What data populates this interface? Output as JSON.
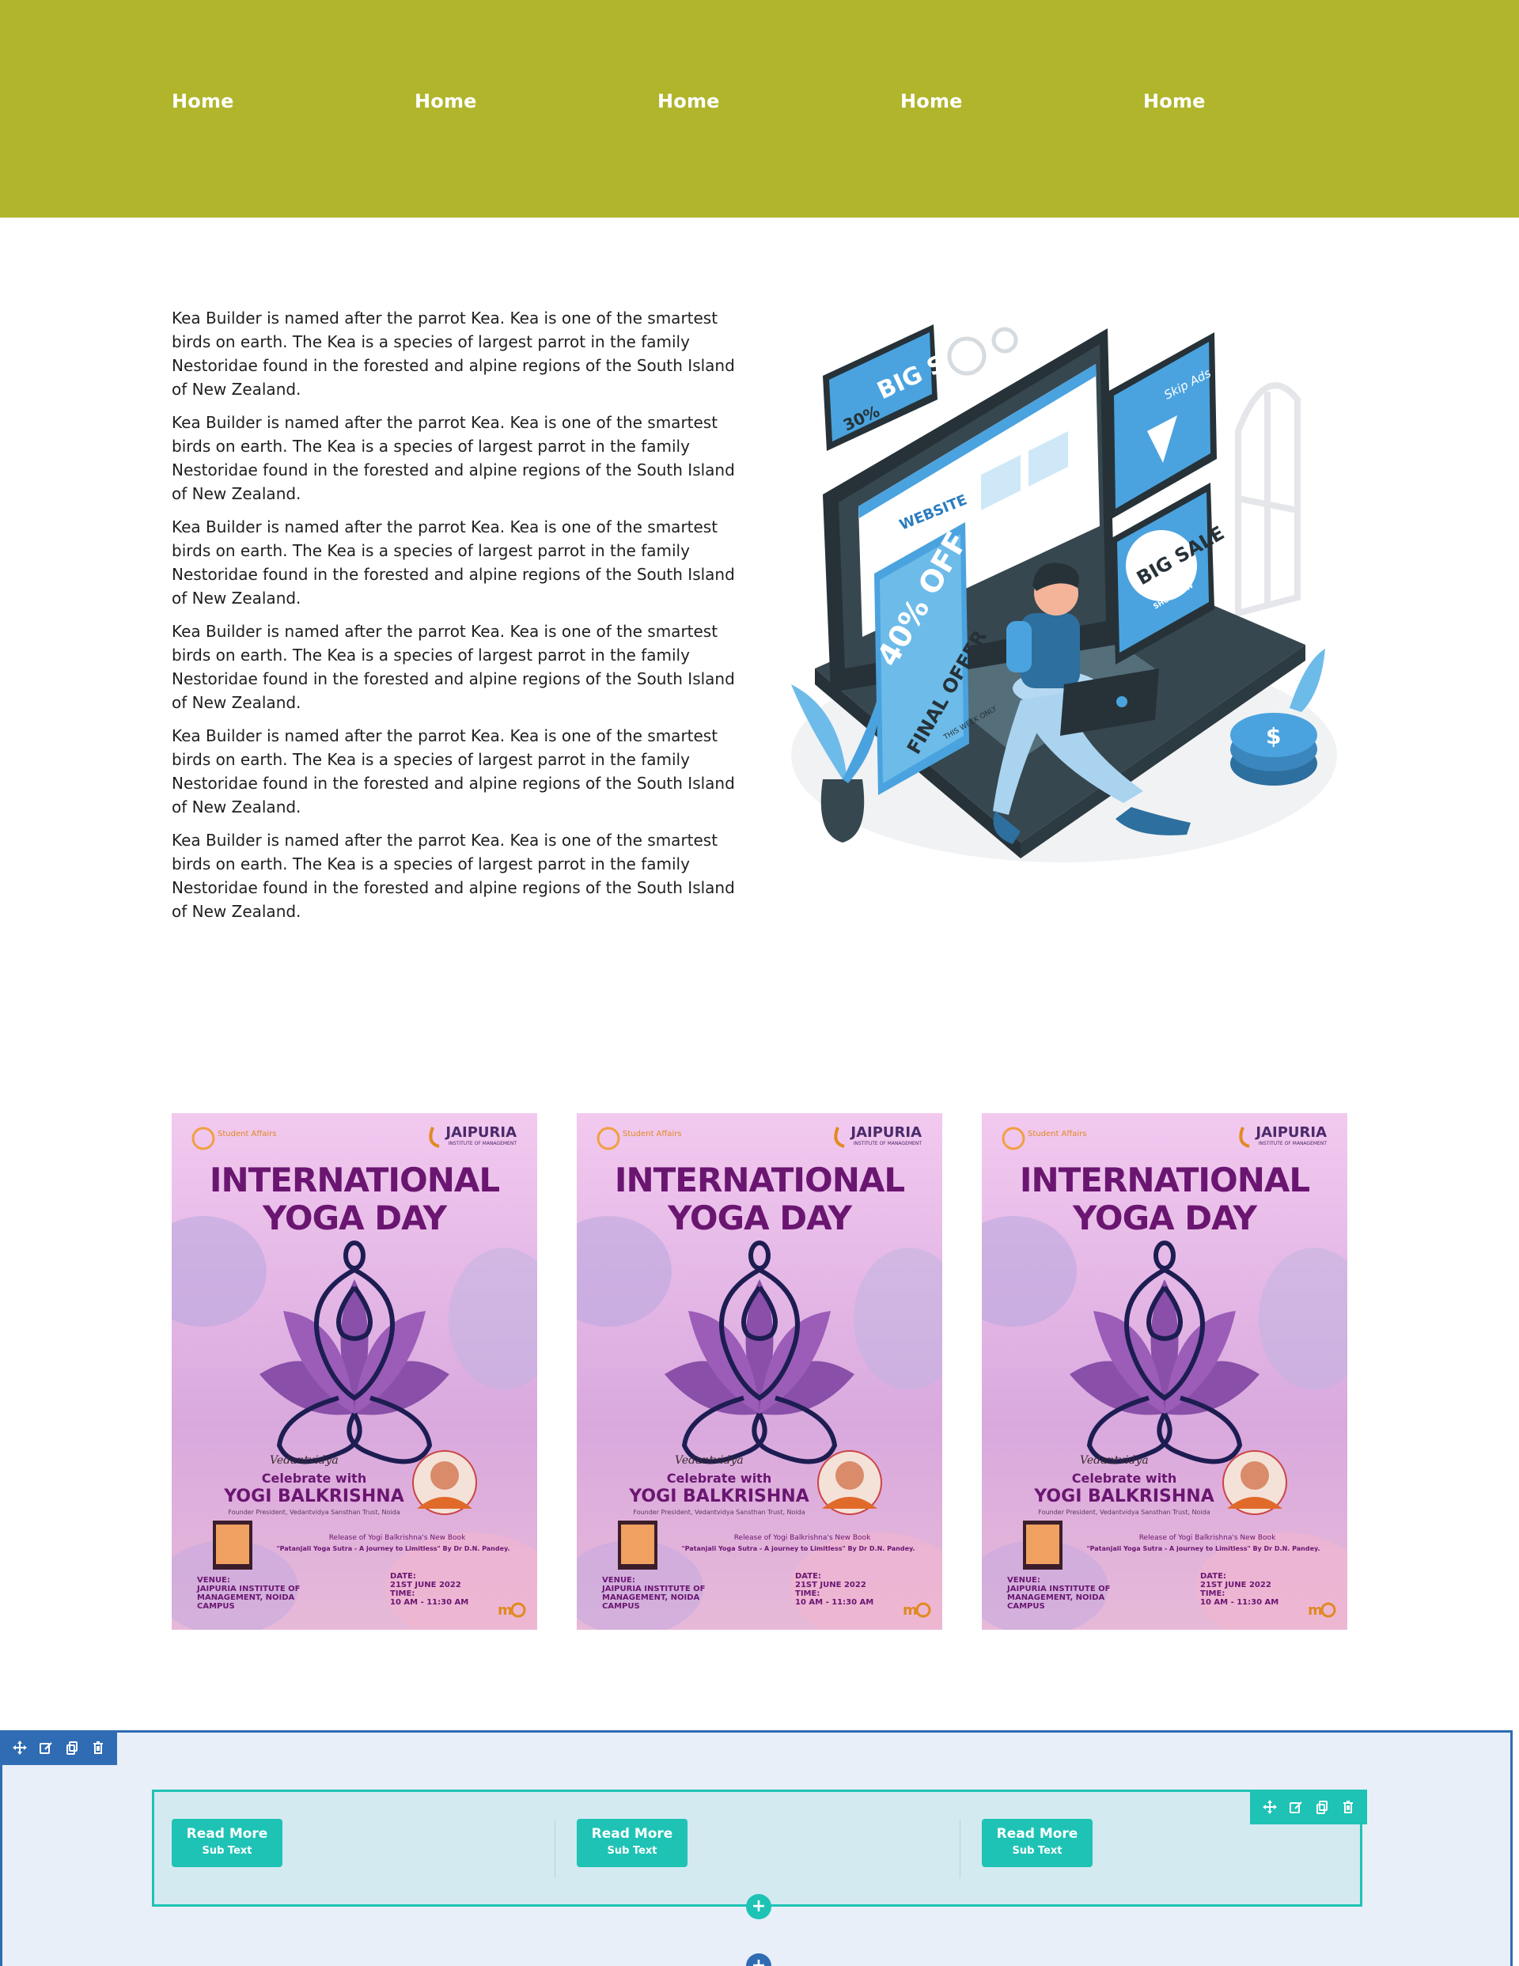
{
  "nav": {
    "items": [
      {
        "label": "Home"
      },
      {
        "label": "Home"
      },
      {
        "label": "Home"
      },
      {
        "label": "Home"
      },
      {
        "label": "Home"
      }
    ]
  },
  "intro": {
    "paragraphs": [
      "Kea Builder is named after the parrot Kea. Kea is one of the smartest birds on earth. The Kea is a species of largest parrot in the family Nestoridae found in the forested and alpine regions of the South Island of New Zealand.",
      "Kea Builder is named after the parrot Kea. Kea is one of the smartest birds on earth. The Kea is a species of largest parrot in the family Nestoridae found in the forested and alpine regions of the South Island of New Zealand.",
      "Kea Builder is named after the parrot Kea. Kea is one of the smartest birds on earth. The Kea is a species of largest parrot in the family Nestoridae found in the forested and alpine regions of the South Island of New Zealand.",
      "Kea Builder is named after the parrot Kea. Kea is one of the smartest birds on earth. The Kea is a species of largest parrot in the family Nestoridae found in the forested and alpine regions of the South Island of New Zealand.",
      "Kea Builder is named after the parrot Kea. Kea is one of the smartest birds on earth. The Kea is a species of largest parrot in the family Nestoridae found in the forested and alpine regions of the South Island of New Zealand.",
      "Kea Builder is named after the parrot Kea. Kea is one of the smartest birds on earth. The Kea is a species of largest parrot in the family Nestoridae found in the forested and alpine regions of the South Island of New Zealand."
    ]
  },
  "illustration": {
    "big_sale": "BIG SALE",
    "big_sale_pct": "30%",
    "skip_ads": "Skip Ads",
    "website": "WEBSITE",
    "pct_off": "40% OFF",
    "final_offer": "FINAL OFFER",
    "this_week_only": "THIS WEEK ONLY",
    "shop_now": "SHOP NOW",
    "dollar": "$"
  },
  "posters": [
    {
      "student_affairs": "Student Affairs",
      "institute": "JAIPURIA",
      "institute_sub": "INSTITUTE OF MANAGEMENT",
      "title_line1": "INTERNATIONAL",
      "title_line2": "YOGA DAY",
      "brand": "Vedantvidya",
      "celebrate": "Celebrate with",
      "guest": "YOGI BALKRISHNA",
      "guest_role": "Founder President, Vedantvidya Sansthan Trust, Noida",
      "release_line": "Release of Yogi Balkrishna's New Book",
      "book_line": "\"Patanjali Yoga Sutra - A journey to Limitless\" By Dr D.N. Pandey.",
      "venue_label": "VENUE:",
      "venue_value": "JAIPURIA INSTITUTE OF MANAGEMENT, NOIDA CAMPUS",
      "date_label": "DATE:",
      "date_value": "21ST JUNE 2022",
      "time_label": "TIME:",
      "time_value": "10 AM - 11:30 AM"
    },
    {
      "student_affairs": "Student Affairs",
      "institute": "JAIPURIA",
      "institute_sub": "INSTITUTE OF MANAGEMENT",
      "title_line1": "INTERNATIONAL",
      "title_line2": "YOGA DAY",
      "brand": "Vedantvidya",
      "celebrate": "Celebrate with",
      "guest": "YOGI BALKRISHNA",
      "guest_role": "Founder President, Vedantvidya Sansthan Trust, Noida",
      "release_line": "Release of Yogi Balkrishna's New Book",
      "book_line": "\"Patanjali Yoga Sutra - A journey to Limitless\" By Dr D.N. Pandey.",
      "venue_label": "VENUE:",
      "venue_value": "JAIPURIA INSTITUTE OF MANAGEMENT, NOIDA CAMPUS",
      "date_label": "DATE:",
      "date_value": "21ST JUNE 2022",
      "time_label": "TIME:",
      "time_value": "10 AM - 11:30 AM"
    },
    {
      "student_affairs": "Student Affairs",
      "institute": "JAIPURIA",
      "institute_sub": "INSTITUTE OF MANAGEMENT",
      "title_line1": "INTERNATIONAL",
      "title_line2": "YOGA DAY",
      "brand": "Vedantvidya",
      "celebrate": "Celebrate with",
      "guest": "YOGI BALKRISHNA",
      "guest_role": "Founder President, Vedantvidya Sansthan Trust, Noida",
      "release_line": "Release of Yogi Balkrishna's New Book",
      "book_line": "\"Patanjali Yoga Sutra - A journey to Limitless\" By Dr D.N. Pandey.",
      "venue_label": "VENUE:",
      "venue_value": "JAIPURIA INSTITUTE OF MANAGEMENT, NOIDA CAMPUS",
      "date_label": "DATE:",
      "date_value": "21ST JUNE 2022",
      "time_label": "TIME:",
      "time_value": "10 AM - 11:30 AM"
    }
  ],
  "editor": {
    "buttons": [
      {
        "label": "Read More",
        "sub": "Sub Text"
      },
      {
        "label": "Read More",
        "sub": "Sub Text"
      },
      {
        "label": "Read More",
        "sub": "Sub Text"
      }
    ],
    "add_symbol": "+"
  },
  "colors": {
    "header_bg": "#b0b52c",
    "editor_blue": "#2f6cb3",
    "editor_teal": "#1ec3b5",
    "poster_title": "#6a1671"
  }
}
